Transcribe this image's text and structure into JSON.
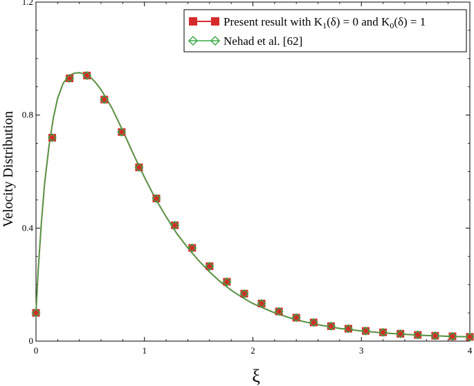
{
  "chart_data": {
    "type": "line",
    "xlabel": "ξ",
    "ylabel": "Velocity Distribution",
    "xlim": [
      0,
      4
    ],
    "ylim": [
      0,
      1.2
    ],
    "xticks": [
      "0",
      "1",
      "2",
      "3",
      "4"
    ],
    "yticks": [
      "0",
      "0.4",
      "0.8",
      "1.2"
    ],
    "grid": false,
    "legend_position": "top-right",
    "series": [
      {
        "name": "Present result with K1(δ) = 0 and K0(δ) = 1",
        "legend_parts": [
          "Present result with K",
          "1",
          "(δ) = 0 and K",
          "0",
          "(δ) = 1"
        ],
        "marker": "square",
        "color": "#d62a2a",
        "x": [
          0,
          0.15,
          0.31,
          0.47,
          0.63,
          0.79,
          0.95,
          1.11,
          1.28,
          1.44,
          1.6,
          1.76,
          1.92,
          2.08,
          2.24,
          2.4,
          2.56,
          2.72,
          2.88,
          3.04,
          3.2,
          3.36,
          3.52,
          3.68,
          3.84,
          4.0
        ],
        "y": [
          0.1,
          0.72,
          0.93,
          0.94,
          0.855,
          0.74,
          0.615,
          0.505,
          0.41,
          0.33,
          0.265,
          0.21,
          0.168,
          0.133,
          0.105,
          0.083,
          0.066,
          0.053,
          0.044,
          0.036,
          0.031,
          0.026,
          0.022,
          0.019,
          0.017,
          0.015
        ]
      },
      {
        "name": "Nehad et al. [62]",
        "marker": "diamond",
        "color": "#3aa845",
        "x": [
          0,
          0.15,
          0.31,
          0.47,
          0.63,
          0.79,
          0.95,
          1.11,
          1.28,
          1.44,
          1.6,
          1.76,
          1.92,
          2.08,
          2.24,
          2.4,
          2.56,
          2.72,
          2.88,
          3.04,
          3.2,
          3.36,
          3.52,
          3.68,
          3.84,
          4.0
        ],
        "y": [
          0.1,
          0.72,
          0.93,
          0.94,
          0.855,
          0.74,
          0.615,
          0.505,
          0.41,
          0.33,
          0.265,
          0.21,
          0.168,
          0.133,
          0.105,
          0.083,
          0.066,
          0.053,
          0.044,
          0.036,
          0.031,
          0.026,
          0.022,
          0.019,
          0.017,
          0.015
        ]
      }
    ],
    "curve": {
      "x": [
        0,
        0.02,
        0.05,
        0.08,
        0.12,
        0.16,
        0.2,
        0.25,
        0.3,
        0.35,
        0.4,
        0.45,
        0.5,
        0.55,
        0.6,
        0.7,
        0.8,
        0.9,
        1.0,
        1.1,
        1.2,
        1.3,
        1.4,
        1.5,
        1.6,
        1.7,
        1.8,
        1.9,
        2.0,
        2.2,
        2.4,
        2.6,
        2.8,
        3.0,
        3.2,
        3.4,
        3.6,
        3.8,
        4.0
      ],
      "y": [
        0.1,
        0.25,
        0.42,
        0.56,
        0.69,
        0.79,
        0.86,
        0.912,
        0.938,
        0.948,
        0.95,
        0.945,
        0.935,
        0.915,
        0.89,
        0.825,
        0.745,
        0.66,
        0.58,
        0.505,
        0.44,
        0.38,
        0.33,
        0.285,
        0.245,
        0.21,
        0.18,
        0.155,
        0.133,
        0.1,
        0.075,
        0.058,
        0.045,
        0.036,
        0.029,
        0.024,
        0.02,
        0.017,
        0.015
      ]
    }
  }
}
